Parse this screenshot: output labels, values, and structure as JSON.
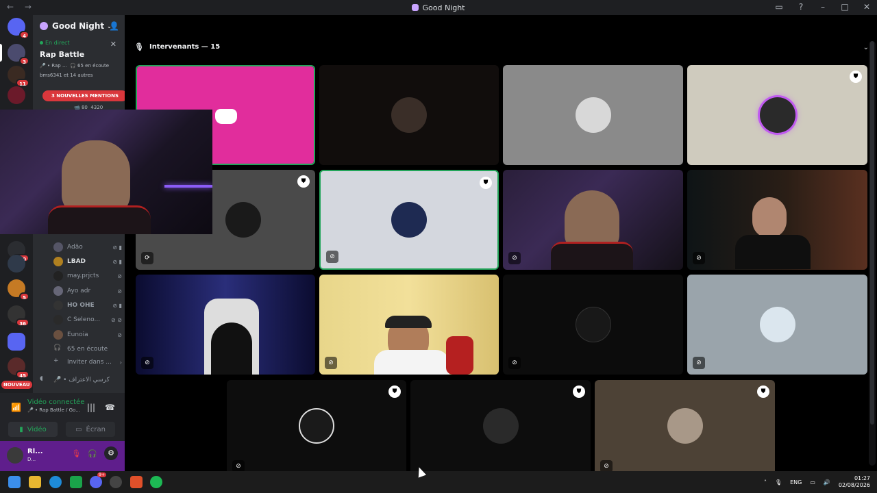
{
  "window": {
    "title": "Good Night",
    "nav": "←  →"
  },
  "sidebar_servers": {
    "badges": [
      "4",
      "3",
      "11",
      "350",
      "5",
      "36",
      "45"
    ],
    "new_label": "NOUVEAU"
  },
  "channel_panel": {
    "server_name": "Good Night",
    "live_label": "En direct",
    "stage_title": "Rap Battle",
    "stage_meta_line1": "🎤 • Rap ...",
    "stage_listening": "65 en écoute",
    "stage_meta_line2": "bms6341 et 14 autres",
    "mentions_badge": "3 NOUVELLES MENTIONS",
    "stage_counts": [
      "80",
      "4320"
    ],
    "members": [
      {
        "name": "Adão"
      },
      {
        "name": "LBAD"
      },
      {
        "name": "may.prjcts"
      },
      {
        "name": "Ayo adr"
      },
      {
        "name": "HO OHE"
      },
      {
        "name": "C Seleno..."
      },
      {
        "name": "Eunoia"
      }
    ],
    "listening_label": "65 en écoute",
    "invite_label": "Inviter dans ...",
    "other_channel": "🎤 • كرسي الاعتراف"
  },
  "voice_panel": {
    "status": "Vidéo connectée",
    "channel": "🎤 • Rap Battle / Go...",
    "video_label": "Vidéo",
    "screen_label": "Écran"
  },
  "user_panel": {
    "name": "Rl...",
    "status": "D..."
  },
  "stage": {
    "speakers_label": "Intervenants — 15",
    "tiles": [
      {
        "kind": "discord-logo",
        "bg": "#e12d9c"
      },
      {
        "kind": "avatar",
        "bg": "#110d0c"
      },
      {
        "kind": "avatar",
        "bg": "#8a8a8a"
      },
      {
        "kind": "avatar",
        "bg": "#cfcbbe"
      },
      {
        "kind": "avatar",
        "bg": "#4a4a4a"
      },
      {
        "kind": "avatar",
        "bg": "#d4d7de"
      },
      {
        "kind": "camera",
        "bg": "#1d1626"
      },
      {
        "kind": "camera",
        "bg": "#2a1e16"
      },
      {
        "kind": "camera",
        "bg": "#12133d"
      },
      {
        "kind": "camera",
        "bg": "#e6cf79"
      },
      {
        "kind": "avatar",
        "bg": "#0c0c0c"
      },
      {
        "kind": "avatar",
        "bg": "#9aa4ab"
      },
      {
        "kind": "avatar",
        "bg": "#0d0d0d"
      },
      {
        "kind": "avatar",
        "bg": "#0d0d0d"
      },
      {
        "kind": "avatar",
        "bg": "#4d4236"
      }
    ]
  },
  "taskbar": {
    "lang": "ENG",
    "time": "01:27",
    "date": "02/08/2026",
    "discord_badge": "9+"
  }
}
